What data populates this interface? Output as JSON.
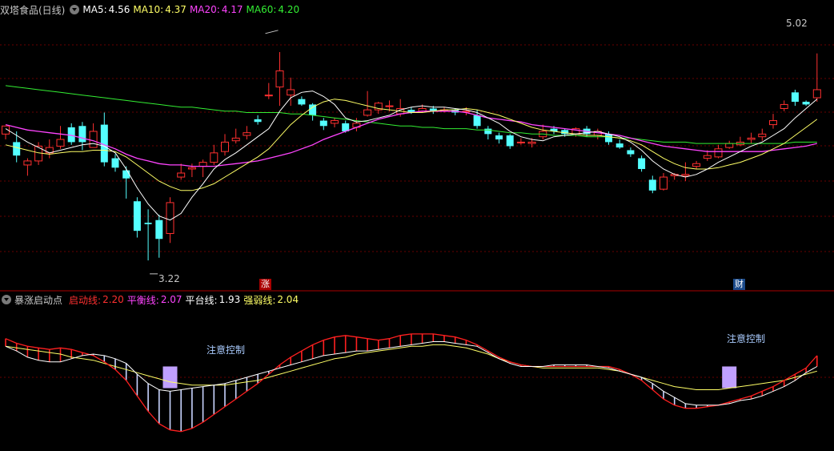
{
  "main_header": {
    "stock": "双塔食品(日线)",
    "ma5_label": "MA5:",
    "ma5_value": "4.56",
    "ma10_label": "MA10:",
    "ma10_value": "4.37",
    "ma20_label": "MA20:",
    "ma20_value": "4.17",
    "ma60_label": "MA60:",
    "ma60_value": "4.20"
  },
  "sub_header": {
    "name": "暴涨启动点",
    "l1_label": "启动线:",
    "l1_value": "2.20",
    "l2_label": "平衡线:",
    "l2_value": "2.07",
    "l3_label": "平台线:",
    "l3_value": "1.93",
    "l4_label": "强弱线:",
    "l4_value": "2.04"
  },
  "markers": {
    "zhang": "涨",
    "cai": "财",
    "high_label": "5.02",
    "low_label": "3.22"
  },
  "signals": {
    "left": "注意控制",
    "right": "注意控制"
  },
  "colors": {
    "up": "#ff3030",
    "down": "#54ffff",
    "ma5": "#ffffff",
    "ma10": "#ffff66",
    "ma20": "#ff44ff",
    "ma60": "#33ee33",
    "grid": "#6a0000",
    "hist_up": "#ff2020",
    "hist_down": "#c8d4ff",
    "bar": "#c0a0ff"
  },
  "chart_data": [
    {
      "type": "candlestick",
      "title": "双塔食品(日线)",
      "ylim": [
        3.1,
        5.15
      ],
      "annotations": {
        "high": 5.02,
        "low": 3.22
      },
      "candles": [
        [
          4.26,
          4.32,
          4.31,
          4.22
        ],
        [
          4.2,
          4.1,
          4.28,
          4.05
        ],
        [
          4.03,
          4.06,
          4.08,
          3.95
        ],
        [
          4.06,
          4.17,
          4.2,
          4.03
        ],
        [
          4.12,
          4.16,
          4.22,
          4.08
        ],
        [
          4.17,
          4.22,
          4.32,
          4.15
        ],
        [
          4.31,
          4.2,
          4.34,
          4.18
        ],
        [
          4.32,
          4.2,
          4.35,
          4.14
        ],
        [
          4.16,
          4.28,
          4.34,
          4.16
        ],
        [
          4.33,
          4.05,
          4.42,
          4.02
        ],
        [
          4.08,
          4.01,
          4.11,
          3.98
        ],
        [
          3.99,
          3.93,
          4.02,
          3.78
        ],
        [
          3.76,
          3.54,
          3.79,
          3.49
        ],
        [
          3.6,
          3.59,
          3.7,
          3.32
        ],
        [
          3.62,
          3.48,
          3.66,
          3.34
        ],
        [
          3.52,
          3.75,
          3.79,
          3.45
        ],
        [
          3.94,
          3.97,
          4.04,
          3.92
        ],
        [
          4.0,
          4.01,
          4.04,
          3.94
        ],
        [
          4.02,
          4.05,
          4.07,
          3.94
        ],
        [
          4.05,
          4.12,
          4.18,
          4.03
        ],
        [
          4.13,
          4.2,
          4.26,
          4.1
        ],
        [
          4.21,
          4.23,
          4.3,
          4.19
        ],
        [
          4.25,
          4.27,
          4.32,
          4.22
        ],
        [
          4.37,
          4.35,
          4.4,
          4.33
        ],
        [
          4.55,
          4.55,
          4.64,
          4.52
        ],
        [
          4.61,
          4.73,
          4.87,
          4.47
        ],
        [
          4.55,
          4.59,
          4.68,
          4.47
        ],
        [
          4.52,
          4.48,
          4.54,
          4.47
        ],
        [
          4.48,
          4.4,
          4.49,
          4.36
        ],
        [
          4.36,
          4.32,
          4.38,
          4.29
        ],
        [
          4.34,
          4.36,
          4.38,
          4.31
        ],
        [
          4.34,
          4.28,
          4.36,
          4.27
        ],
        [
          4.31,
          4.34,
          4.38,
          4.28
        ],
        [
          4.4,
          4.44,
          4.58,
          4.39
        ],
        [
          4.44,
          4.49,
          4.5,
          4.41
        ],
        [
          4.47,
          4.47,
          4.51,
          4.43
        ],
        [
          4.41,
          4.45,
          4.52,
          4.39
        ],
        [
          4.44,
          4.42,
          4.46,
          4.41
        ],
        [
          4.43,
          4.45,
          4.48,
          4.42
        ],
        [
          4.45,
          4.43,
          4.47,
          4.41
        ],
        [
          4.44,
          4.44,
          4.46,
          4.42
        ],
        [
          4.44,
          4.42,
          4.45,
          4.4
        ],
        [
          4.43,
          4.43,
          4.46,
          4.4
        ],
        [
          4.4,
          4.32,
          4.44,
          4.3
        ],
        [
          4.3,
          4.26,
          4.32,
          4.22
        ],
        [
          4.25,
          4.22,
          4.27,
          4.19
        ],
        [
          4.25,
          4.17,
          4.26,
          4.15
        ],
        [
          4.2,
          4.2,
          4.23,
          4.18
        ],
        [
          4.19,
          4.2,
          4.23,
          4.16
        ],
        [
          4.24,
          4.28,
          4.33,
          4.22
        ],
        [
          4.3,
          4.28,
          4.32,
          4.26
        ],
        [
          4.29,
          4.26,
          4.3,
          4.24
        ],
        [
          4.26,
          4.3,
          4.31,
          4.24
        ],
        [
          4.3,
          4.26,
          4.32,
          4.24
        ],
        [
          4.25,
          4.28,
          4.3,
          4.22
        ],
        [
          4.26,
          4.2,
          4.28,
          4.18
        ],
        [
          4.19,
          4.16,
          4.22,
          4.15
        ],
        [
          4.14,
          4.11,
          4.16,
          4.09
        ],
        [
          4.08,
          4.0,
          4.1,
          3.98
        ],
        [
          3.92,
          3.84,
          3.95,
          3.82
        ],
        [
          3.85,
          3.94,
          3.97,
          3.84
        ],
        [
          3.95,
          3.96,
          3.97,
          3.92
        ],
        [
          3.95,
          3.96,
          4.05,
          3.91
        ],
        [
          4.02,
          4.04,
          4.06,
          4.0
        ],
        [
          4.08,
          4.1,
          4.14,
          4.06
        ],
        [
          4.09,
          4.15,
          4.18,
          4.08
        ],
        [
          4.16,
          4.19,
          4.21,
          4.15
        ],
        [
          4.18,
          4.2,
          4.24,
          4.17
        ],
        [
          4.22,
          4.23,
          4.27,
          4.19
        ],
        [
          4.24,
          4.26,
          4.3,
          4.21
        ],
        [
          4.33,
          4.36,
          4.41,
          4.3
        ],
        [
          4.45,
          4.48,
          4.51,
          4.43
        ],
        [
          4.57,
          4.5,
          4.59,
          4.47
        ],
        [
          4.5,
          4.48,
          4.51,
          4.47
        ],
        [
          4.53,
          4.59,
          4.86,
          4.5
        ]
      ],
      "ma5": [
        4.3,
        4.25,
        4.2,
        4.16,
        4.12,
        4.14,
        4.16,
        4.18,
        4.19,
        4.17,
        4.12,
        4.0,
        3.86,
        3.74,
        3.65,
        3.62,
        3.67,
        3.79,
        3.89,
        4.0,
        4.07,
        4.12,
        4.18,
        4.24,
        4.3,
        4.43,
        4.53,
        4.57,
        4.58,
        4.54,
        4.48,
        4.38,
        4.35,
        4.36,
        4.38,
        4.4,
        4.44,
        4.46,
        4.47,
        4.46,
        4.46,
        4.45,
        4.44,
        4.42,
        4.38,
        4.34,
        4.28,
        4.24,
        4.22,
        4.21,
        4.24,
        4.25,
        4.26,
        4.27,
        4.28,
        4.26,
        4.24,
        4.2,
        4.14,
        4.06,
        4.0,
        3.96,
        3.94,
        3.96,
        4.0,
        4.05,
        4.09,
        4.13,
        4.17,
        4.2,
        4.25,
        4.3,
        4.38,
        4.45,
        4.52
      ],
      "ma10": [
        4.18,
        4.16,
        4.14,
        4.12,
        4.11,
        4.12,
        4.13,
        4.13,
        4.14,
        4.14,
        4.13,
        4.09,
        4.03,
        3.97,
        3.91,
        3.87,
        3.84,
        3.84,
        3.86,
        3.89,
        3.94,
        3.99,
        4.04,
        4.09,
        4.15,
        4.24,
        4.33,
        4.4,
        4.46,
        4.5,
        4.52,
        4.51,
        4.49,
        4.47,
        4.45,
        4.44,
        4.43,
        4.42,
        4.42,
        4.43,
        4.44,
        4.44,
        4.45,
        4.44,
        4.42,
        4.4,
        4.37,
        4.34,
        4.31,
        4.29,
        4.28,
        4.27,
        4.26,
        4.25,
        4.25,
        4.24,
        4.23,
        4.21,
        4.18,
        4.13,
        4.08,
        4.04,
        4.01,
        4.0,
        4.0,
        4.01,
        4.03,
        4.05,
        4.08,
        4.11,
        4.15,
        4.19,
        4.25,
        4.31,
        4.37
      ],
      "ma20": [
        4.33,
        4.31,
        4.29,
        4.28,
        4.27,
        4.26,
        4.25,
        4.23,
        4.21,
        4.18,
        4.15,
        4.11,
        4.08,
        4.06,
        4.04,
        4.03,
        4.03,
        4.02,
        4.02,
        4.02,
        4.03,
        4.04,
        4.05,
        4.06,
        4.08,
        4.1,
        4.12,
        4.15,
        4.18,
        4.22,
        4.25,
        4.28,
        4.31,
        4.34,
        4.37,
        4.39,
        4.41,
        4.42,
        4.43,
        4.43,
        4.43,
        4.43,
        4.42,
        4.4,
        4.38,
        4.37,
        4.36,
        4.35,
        4.33,
        4.32,
        4.31,
        4.3,
        4.29,
        4.28,
        4.27,
        4.26,
        4.25,
        4.23,
        4.21,
        4.19,
        4.17,
        4.16,
        4.15,
        4.14,
        4.13,
        4.13,
        4.13,
        4.13,
        4.13,
        4.13,
        4.14,
        4.15,
        4.16,
        4.17,
        4.19
      ],
      "ma60": [
        4.62,
        4.61,
        4.6,
        4.59,
        4.58,
        4.57,
        4.56,
        4.55,
        4.54,
        4.53,
        4.52,
        4.51,
        4.5,
        4.49,
        4.48,
        4.47,
        4.46,
        4.46,
        4.45,
        4.44,
        4.43,
        4.43,
        4.42,
        4.42,
        4.42,
        4.42,
        4.41,
        4.41,
        4.4,
        4.39,
        4.38,
        4.37,
        4.36,
        4.35,
        4.34,
        4.33,
        4.32,
        4.32,
        4.31,
        4.31,
        4.3,
        4.3,
        4.3,
        4.29,
        4.29,
        4.28,
        4.27,
        4.27,
        4.26,
        4.26,
        4.25,
        4.25,
        4.25,
        4.24,
        4.24,
        4.24,
        4.23,
        4.23,
        4.22,
        4.21,
        4.2,
        4.2,
        4.2,
        4.19,
        4.19,
        4.19,
        4.19,
        4.19,
        4.19,
        4.19,
        4.19,
        4.19,
        4.2,
        4.2,
        4.2
      ]
    },
    {
      "type": "indicator",
      "title": "暴涨启动点",
      "ylim": [
        1.55,
        2.45
      ],
      "line1": [
        2.25,
        2.22,
        2.2,
        2.19,
        2.18,
        2.19,
        2.18,
        2.16,
        2.14,
        2.1,
        2.05,
        1.98,
        1.88,
        1.78,
        1.7,
        1.66,
        1.65,
        1.67,
        1.71,
        1.76,
        1.81,
        1.86,
        1.91,
        1.96,
        2.02,
        2.08,
        2.13,
        2.17,
        2.21,
        2.24,
        2.26,
        2.27,
        2.26,
        2.25,
        2.24,
        2.25,
        2.27,
        2.28,
        2.28,
        2.28,
        2.27,
        2.26,
        2.24,
        2.21,
        2.17,
        2.13,
        2.1,
        2.08,
        2.07,
        2.07,
        2.07,
        2.07,
        2.07,
        2.07,
        2.07,
        2.07,
        2.05,
        2.02,
        1.98,
        1.92,
        1.86,
        1.82,
        1.8,
        1.8,
        1.81,
        1.82,
        1.84,
        1.86,
        1.88,
        1.91,
        1.94,
        1.98,
        2.02,
        2.06,
        2.14
      ],
      "line2": [
        2.2,
        2.17,
        2.13,
        2.11,
        2.1,
        2.1,
        2.12,
        2.14,
        2.15,
        2.14,
        2.12,
        2.09,
        2.02,
        1.96,
        1.92,
        1.91,
        1.92,
        1.93,
        1.94,
        1.95,
        1.96,
        1.98,
        2.0,
        2.02,
        2.04,
        2.06,
        2.08,
        2.1,
        2.12,
        2.14,
        2.15,
        2.16,
        2.17,
        2.17,
        2.18,
        2.19,
        2.2,
        2.21,
        2.22,
        2.23,
        2.23,
        2.22,
        2.21,
        2.2,
        2.16,
        2.12,
        2.09,
        2.07,
        2.07,
        2.07,
        2.08,
        2.08,
        2.08,
        2.08,
        2.07,
        2.06,
        2.04,
        2.02,
        2.0,
        1.96,
        1.91,
        1.87,
        1.83,
        1.82,
        1.82,
        1.82,
        1.83,
        1.85,
        1.86,
        1.88,
        1.91,
        1.94,
        1.98,
        2.03,
        2.07
      ],
      "line3": [
        2.2,
        2.19,
        2.18,
        2.17,
        2.16,
        2.15,
        2.13,
        2.12,
        2.11,
        2.09,
        2.07,
        2.05,
        2.03,
        2.01,
        1.99,
        1.97,
        1.96,
        1.95,
        1.95,
        1.95,
        1.95,
        1.96,
        1.97,
        1.98,
        2.0,
        2.02,
        2.04,
        2.06,
        2.08,
        2.1,
        2.12,
        2.13,
        2.15,
        2.16,
        2.17,
        2.18,
        2.19,
        2.2,
        2.2,
        2.21,
        2.21,
        2.2,
        2.19,
        2.17,
        2.15,
        2.12,
        2.1,
        2.08,
        2.07,
        2.06,
        2.06,
        2.06,
        2.06,
        2.06,
        2.06,
        2.05,
        2.04,
        2.02,
        2.0,
        1.98,
        1.96,
        1.94,
        1.93,
        1.92,
        1.92,
        1.92,
        1.93,
        1.94,
        1.95,
        1.96,
        1.97,
        1.98,
        2.0,
        2.02,
        2.04
      ],
      "signal_bars": [
        {
          "index": 15,
          "from": 1.93,
          "to": 2.07
        },
        {
          "index": 66,
          "from": 1.93,
          "to": 2.07
        }
      ]
    }
  ]
}
